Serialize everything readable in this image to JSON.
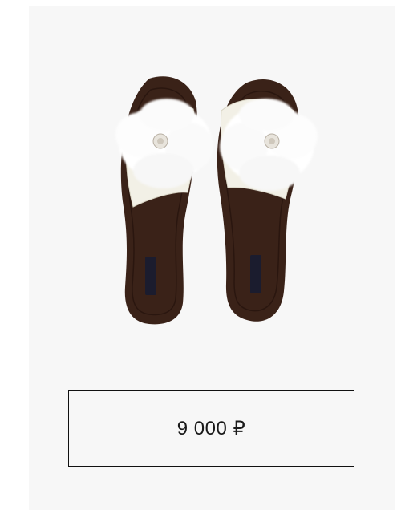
{
  "product": {
    "image_alt": "fur-slippers",
    "price": "9 000 ₽",
    "colors": {
      "card_background": "#f7f7f7",
      "sole": "#3a2218",
      "fur": "#ffffff",
      "strap": "#f2f0e6"
    }
  }
}
